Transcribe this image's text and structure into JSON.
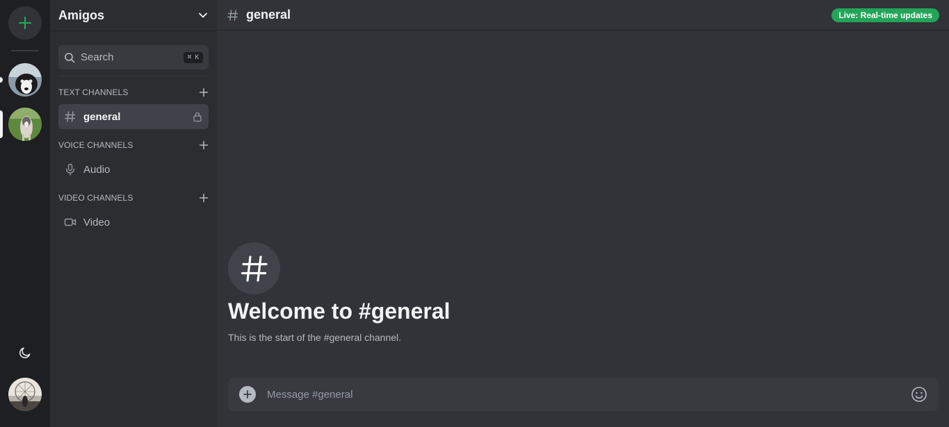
{
  "server": {
    "name": "Amigos"
  },
  "search": {
    "label": "Search",
    "shortcut": "⌘ K"
  },
  "categories": [
    {
      "label": "TEXT CHANNELS"
    },
    {
      "label": "VOICE CHANNELS"
    },
    {
      "label": "VIDEO CHANNELS"
    }
  ],
  "channels": [
    {
      "label": "general",
      "icon": "hash-icon",
      "active": true
    },
    {
      "label": "Audio",
      "icon": "microphone-icon",
      "active": false
    },
    {
      "label": "Video",
      "icon": "video-camera-icon",
      "active": false
    }
  ],
  "topbar": {
    "channel": "general",
    "badge": "Live: Real-time updates"
  },
  "welcome": {
    "title": "Welcome to #general",
    "subtitle": "This is the start of the #general channel."
  },
  "composer": {
    "placeholder": "Message #general"
  },
  "colors": {
    "accent": "#23a559",
    "rail_bg": "#1e1f22",
    "sidebar_bg": "#2b2d31",
    "main_bg": "#313338"
  }
}
